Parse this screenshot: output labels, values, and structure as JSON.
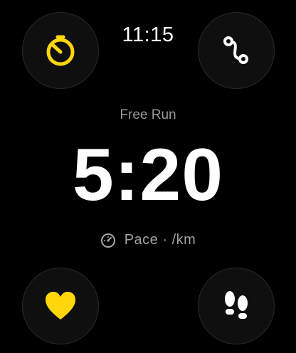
{
  "status": {
    "time": "11:15"
  },
  "workout": {
    "name": "Free Run"
  },
  "metric": {
    "value": "5:20",
    "label": "Pace · /km"
  },
  "buttons": {
    "top_left": {
      "icon": "timer-icon"
    },
    "top_right": {
      "icon": "route-icon"
    },
    "bottom_left": {
      "icon": "heart-icon"
    },
    "bottom_right": {
      "icon": "footsteps-icon"
    }
  },
  "colors": {
    "accent": "#ffd60a",
    "background": "#000000",
    "button_fill": "#0f0f0f",
    "muted_text": "#9a9a9a"
  }
}
